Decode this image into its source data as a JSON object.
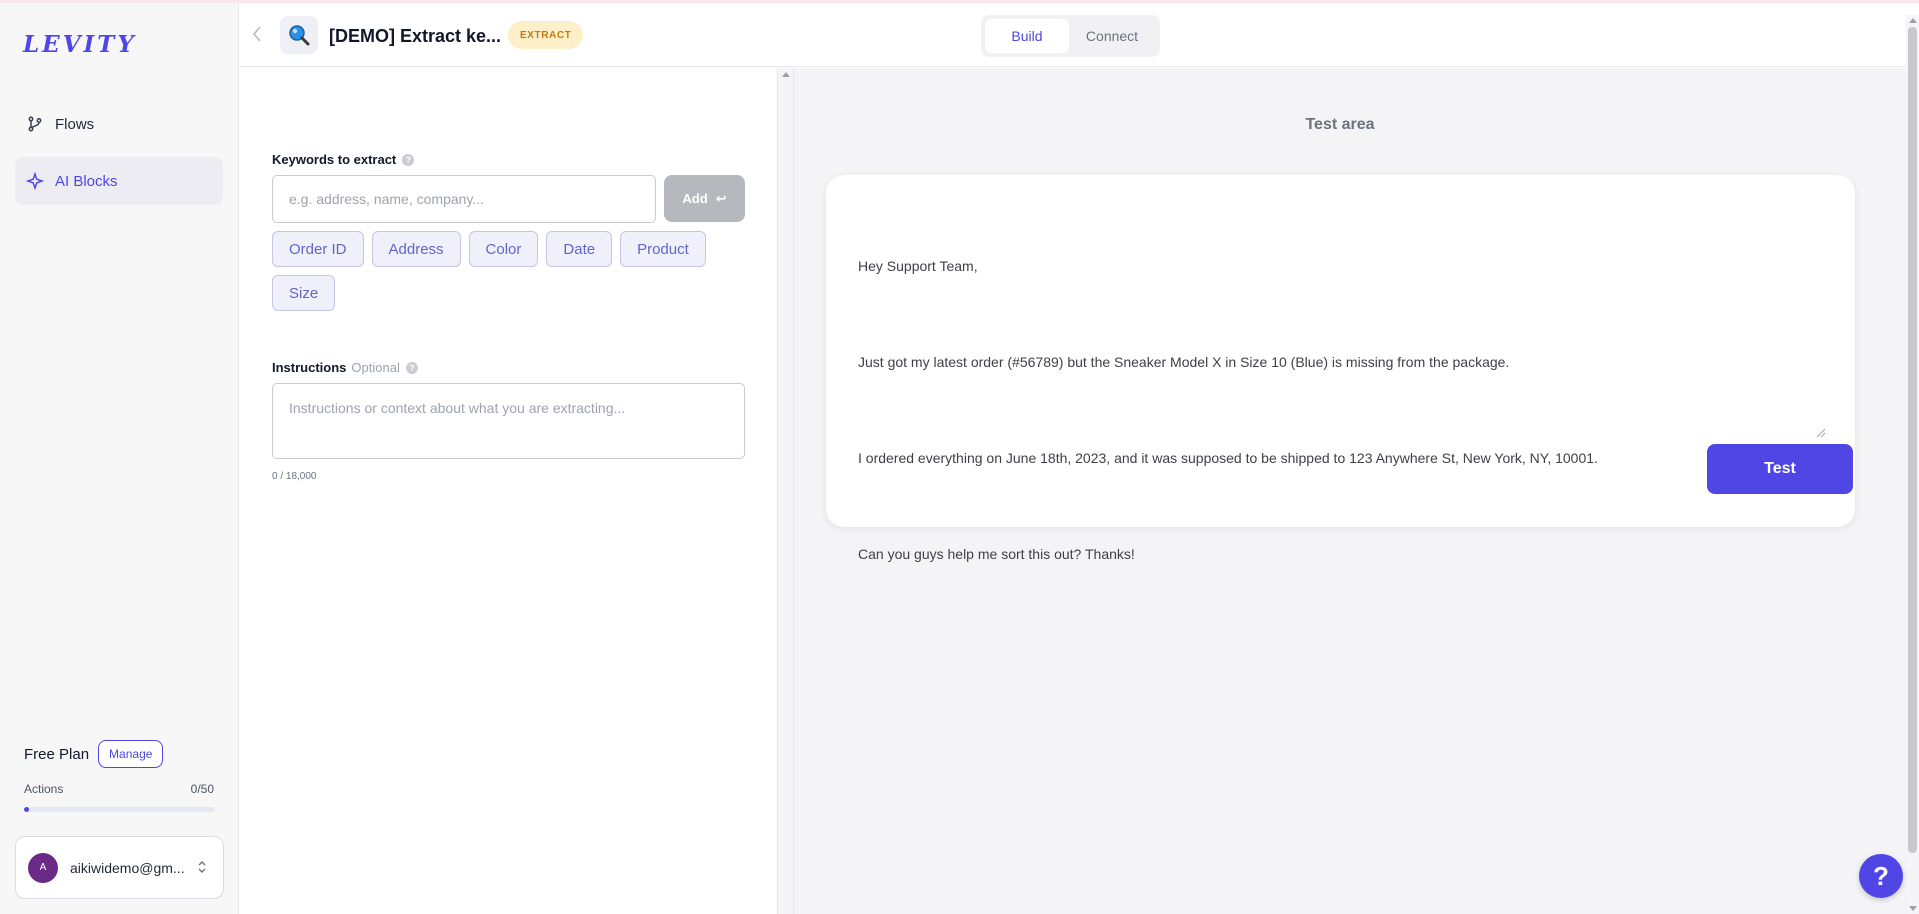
{
  "brand": {
    "logo_text": "LEVITY",
    "accent_color": "#4f46e5"
  },
  "sidebar": {
    "items": [
      {
        "label": "Flows",
        "icon": "git-branch-icon",
        "active": false
      },
      {
        "label": "AI Blocks",
        "icon": "sparkle-icon",
        "active": true
      }
    ],
    "plan": {
      "name": "Free Plan",
      "manage_label": "Manage",
      "actions_label": "Actions",
      "actions_count": "0/50",
      "actions_used": 0,
      "actions_limit": 50
    },
    "user": {
      "avatar_initial": "A",
      "email": "aikiwidemo@gm..."
    }
  },
  "header": {
    "block_icon": "magnifier-icon",
    "title": "[DEMO] Extract ke...",
    "badge": "EXTRACT",
    "tabs": [
      {
        "label": "Build",
        "active": true
      },
      {
        "label": "Connect",
        "active": false
      }
    ]
  },
  "config": {
    "keywords_label": "Keywords to extract",
    "keywords_placeholder": "e.g. address, name, company...",
    "add_label": "Add",
    "keywords": [
      "Order ID",
      "Address",
      "Color",
      "Date",
      "Product",
      "Size"
    ],
    "instructions_label": "Instructions",
    "instructions_optional": "Optional",
    "instructions_placeholder": "Instructions or context about what you are extracting...",
    "char_count": "0 / 18,000"
  },
  "test": {
    "title": "Test area",
    "lines": [
      "Hey Support Team,",
      "Just got my latest order (#56789) but the Sneaker Model X in Size 10 (Blue) is missing from the package.",
      "I ordered everything on June 18th, 2023, and it was supposed to be shipped to 123 Anywhere St, New York, NY, 10001.",
      "Can you guys help me sort this out? Thanks!"
    ],
    "button_label": "Test"
  },
  "help_fab": "?"
}
